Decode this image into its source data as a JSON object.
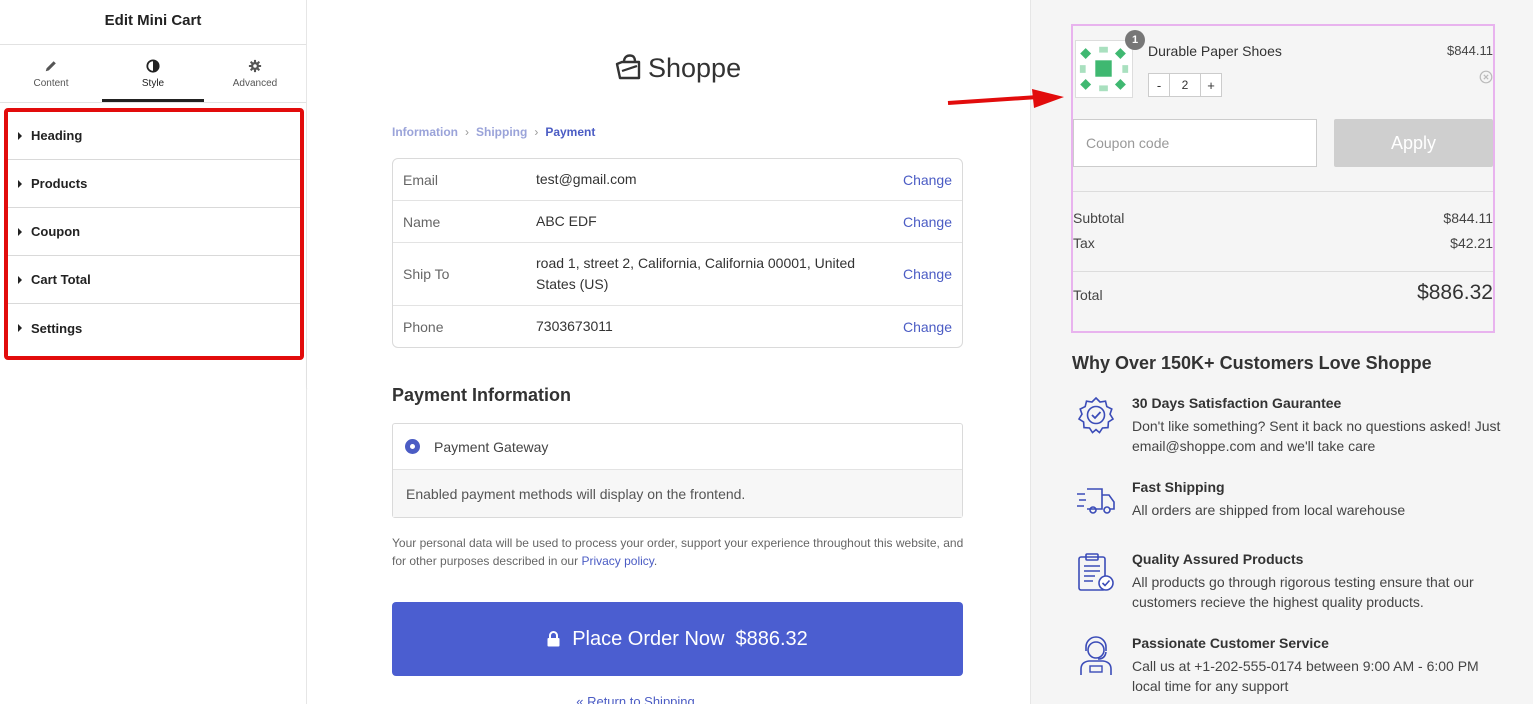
{
  "editor": {
    "title": "Edit Mini Cart",
    "tabs": [
      {
        "label": "Content",
        "icon": "pencil-icon"
      },
      {
        "label": "Style",
        "icon": "contrast-icon"
      },
      {
        "label": "Advanced",
        "icon": "gear-icon"
      }
    ],
    "active_tab": "Style",
    "sections": [
      "Heading",
      "Products",
      "Coupon",
      "Cart Total",
      "Settings"
    ],
    "highlight_color": "#e20c0c",
    "collapse_icon": "‹"
  },
  "checkout": {
    "logo_text": "Shoppe",
    "breadcrumb": [
      "Information",
      "Shipping",
      "Payment"
    ],
    "breadcrumb_separator": "›",
    "review_rows": [
      {
        "label": "Email",
        "value": "test@gmail.com",
        "action": "Change"
      },
      {
        "label": "Name",
        "value": "ABC EDF",
        "action": "Change"
      },
      {
        "label": "Ship To",
        "value": "road 1, street 2, California, California 00001, United States (US)",
        "action": "Change"
      },
      {
        "label": "Phone",
        "value": "7303673011",
        "action": "Change"
      }
    ],
    "payment_heading": "Payment Information",
    "payment_option": "Payment Gateway",
    "payment_note": "Enabled payment methods will display on the frontend.",
    "privacy_text": "Your personal data will be used to process your order, support your experience throughout this website, and for other purposes described in our",
    "privacy_link": "Privacy policy",
    "privacy_end": ".",
    "place_order_label": "Place Order Now",
    "place_order_amount": "$886.32",
    "return_link": "« Return to Shipping",
    "accent_color": "#4b5ed0"
  },
  "summary": {
    "product": {
      "name": "Durable Paper Shoes",
      "price": "$844.11",
      "badge": "1",
      "qty": "2",
      "minus": "-",
      "plus": "+"
    },
    "coupon_placeholder": "Coupon code",
    "apply_label": "Apply",
    "subtotal_label": "Subtotal",
    "subtotal_value": "$844.11",
    "tax_label": "Tax",
    "tax_value": "$42.21",
    "total_label": "Total",
    "total_value": "$886.32",
    "highlight_color": "#e8b3ee"
  },
  "why": {
    "heading": "Why Over 150K+ Customers Love Shoppe",
    "features": [
      {
        "icon": "badge-check-icon",
        "title": "30 Days Satisfaction Gaurantee",
        "desc": "Don't like something? Sent it back no questions asked! Just email@shoppe.com and we'll take care"
      },
      {
        "icon": "truck-icon",
        "title": "Fast Shipping",
        "desc": "All orders are shipped from local warehouse"
      },
      {
        "icon": "clipboard-check-icon",
        "title": "Quality Assured Products",
        "desc": "All products go through rigorous testing ensure that our customers recieve the highest quality products."
      },
      {
        "icon": "support-agent-icon",
        "title": "Passionate Customer Service",
        "desc": "Call us at +1-202-555-0174 between 9:00 AM - 6:00 PM local time for any support"
      }
    ]
  }
}
